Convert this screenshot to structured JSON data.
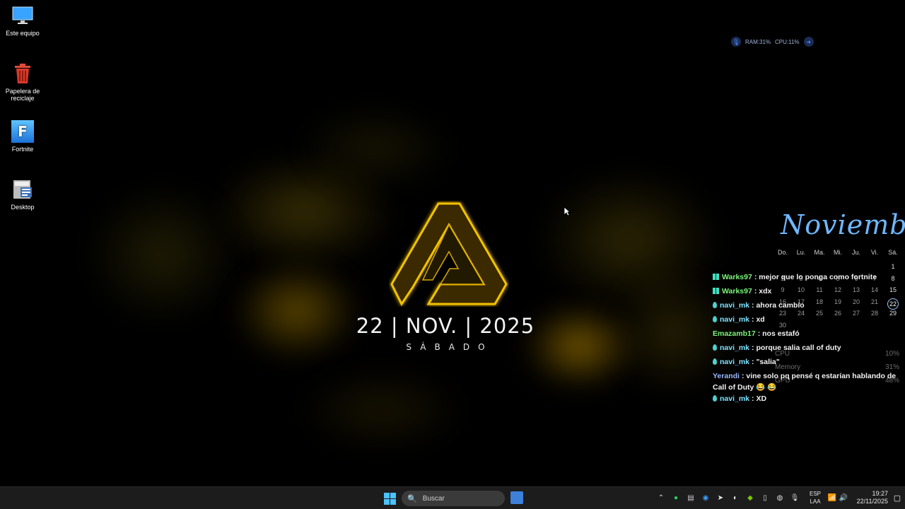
{
  "desktop": {
    "icons": [
      {
        "label": "Este equipo",
        "icon": "monitor-icon"
      },
      {
        "label": "Papelera de reciclaje",
        "icon": "recycle-bin-icon"
      },
      {
        "label": "Fortnite",
        "icon": "fortnite-icon"
      },
      {
        "label": "Desktop",
        "icon": "shortcut-icon"
      }
    ]
  },
  "wallpaper": {
    "date": "22 | NOV. | 2025",
    "day": "SÁBADO",
    "accent_color": "#f2c200"
  },
  "system_widget": {
    "ram": "RAM:31%",
    "cpu": "CPU:11%"
  },
  "calendar": {
    "month": "Noviembre",
    "weekdays": [
      "Do.",
      "Lu.",
      "Ma.",
      "Mi.",
      "Ju.",
      "Vi.",
      "Sá."
    ],
    "weeks": [
      [
        "",
        "",
        "",
        "",
        "",
        "",
        "1"
      ],
      [
        "2",
        "3",
        "4",
        "5",
        "6",
        "7",
        "8"
      ],
      [
        "9",
        "10",
        "11",
        "12",
        "13",
        "14",
        "15"
      ],
      [
        "16",
        "17",
        "18",
        "19",
        "20",
        "21",
        "22"
      ],
      [
        "23",
        "24",
        "25",
        "26",
        "27",
        "28",
        "29"
      ],
      [
        "30",
        "",
        "",
        "",
        "",
        "",
        ""
      ]
    ],
    "today": "22",
    "accent_color": "#6fb7ff"
  },
  "stats": [
    {
      "label": "CPU",
      "value": "10%"
    },
    {
      "label": "Memory",
      "value": "31%"
    },
    {
      "label": "GPU",
      "value": "48%"
    }
  ],
  "chat": [
    {
      "user": "Warks97",
      "text": ": mejor que lo ponga como fortnite",
      "color": "#7cf57c",
      "badge": "grid"
    },
    {
      "user": "Warks97",
      "text": ": xdx",
      "color": "#7cf57c",
      "badge": "grid"
    },
    {
      "user": "navi_mk",
      "text": ": ahora cambio",
      "color": "#7fe3ff",
      "badge": "drop"
    },
    {
      "user": "navi_mk",
      "text": ": xd",
      "color": "#7fe3ff",
      "badge": "drop"
    },
    {
      "user": "Emazamb17",
      "text": ": nos estafó",
      "color": "#7cf57c",
      "badge": ""
    },
    {
      "user": "navi_mk",
      "text": ": porque salia call of duty",
      "color": "#7fe3ff",
      "badge": "drop"
    },
    {
      "user": "navi_mk",
      "text": ": \"salia\"",
      "color": "#7fe3ff",
      "badge": "drop"
    },
    {
      "user": "Yerandi",
      "text": ": vine solo pq pensé q estarían hablando de Call of Duty 😂 😂",
      "color": "#9ab8ff",
      "badge": ""
    },
    {
      "user": "navi_mk",
      "text": ": XD",
      "color": "#7fe3ff",
      "badge": "drop"
    }
  ],
  "taskbar": {
    "search_placeholder": "Buscar",
    "language": "ESP",
    "layout": "LAA",
    "time": "19:27",
    "date": "22/11/2025"
  }
}
